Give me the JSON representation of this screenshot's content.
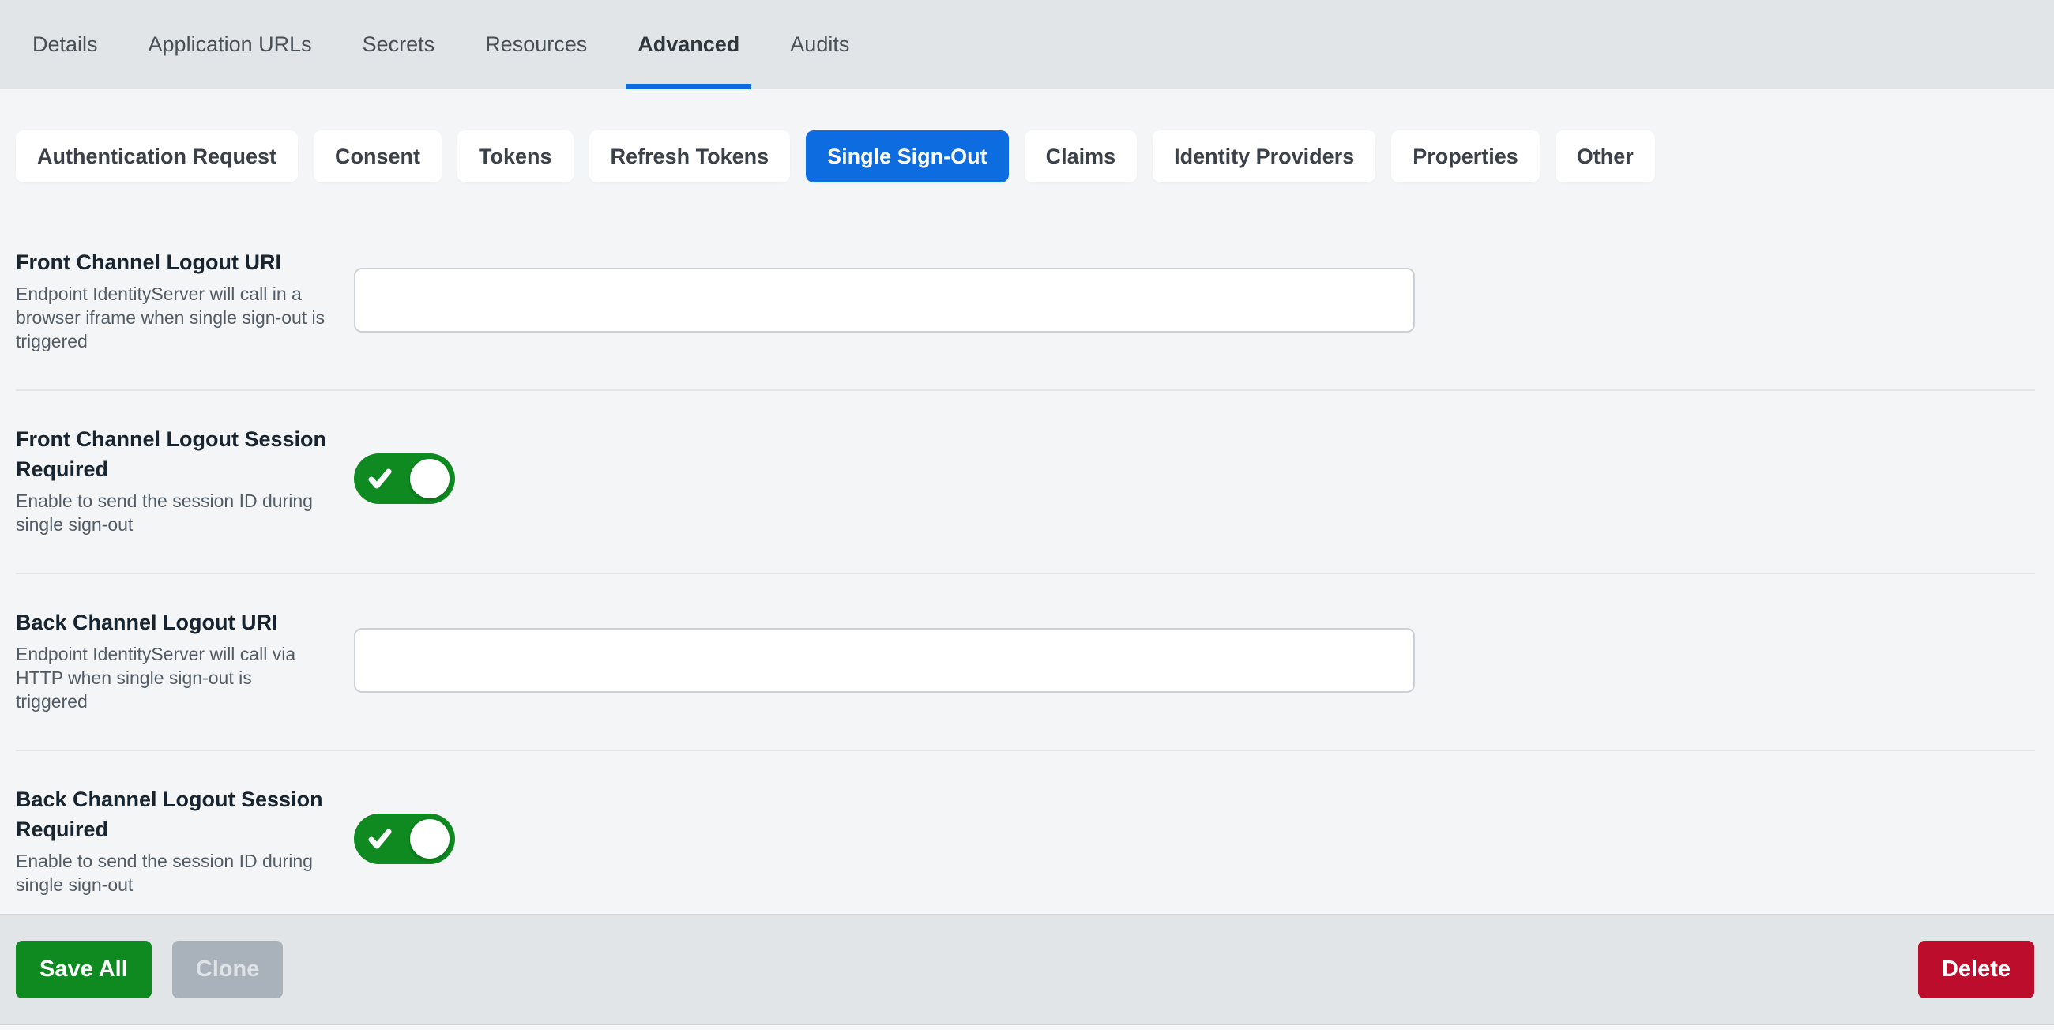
{
  "colors": {
    "accent_blue": "#0c6ce0",
    "success_green": "#0e8a20",
    "danger_red": "#bd0d2c",
    "disabled_gray": "#a9b2bb",
    "tabbar_bg": "#e2e5e8",
    "content_bg": "#f4f5f6"
  },
  "tabs": {
    "items": [
      {
        "label": "Details",
        "active": false
      },
      {
        "label": "Application URLs",
        "active": false
      },
      {
        "label": "Secrets",
        "active": false
      },
      {
        "label": "Resources",
        "active": false
      },
      {
        "label": "Advanced",
        "active": true
      },
      {
        "label": "Audits",
        "active": false
      }
    ]
  },
  "subtabs": {
    "items": [
      {
        "label": "Authentication Request",
        "active": false
      },
      {
        "label": "Consent",
        "active": false
      },
      {
        "label": "Tokens",
        "active": false
      },
      {
        "label": "Refresh Tokens",
        "active": false
      },
      {
        "label": "Single Sign-Out",
        "active": true
      },
      {
        "label": "Claims",
        "active": false
      },
      {
        "label": "Identity Providers",
        "active": false
      },
      {
        "label": "Properties",
        "active": false
      },
      {
        "label": "Other",
        "active": false
      }
    ]
  },
  "form": {
    "sections": [
      {
        "label": "Front Channel Logout URI",
        "description": "Endpoint IdentityServer will call in a browser iframe when single sign-out is triggered",
        "control": "input",
        "value": ""
      },
      {
        "label": "Front Channel Logout Session Required",
        "description": "Enable to send the session ID during single sign-out",
        "control": "toggle",
        "checked": true
      },
      {
        "label": "Back Channel Logout URI",
        "description": "Endpoint IdentityServer will call via HTTP when single sign-out is triggered",
        "control": "input",
        "value": ""
      },
      {
        "label": "Back Channel Logout Session Required",
        "description": "Enable to send the session ID during single sign-out",
        "control": "toggle",
        "checked": true
      }
    ]
  },
  "footer": {
    "save_label": "Save All",
    "clone_label": "Clone",
    "delete_label": "Delete"
  }
}
